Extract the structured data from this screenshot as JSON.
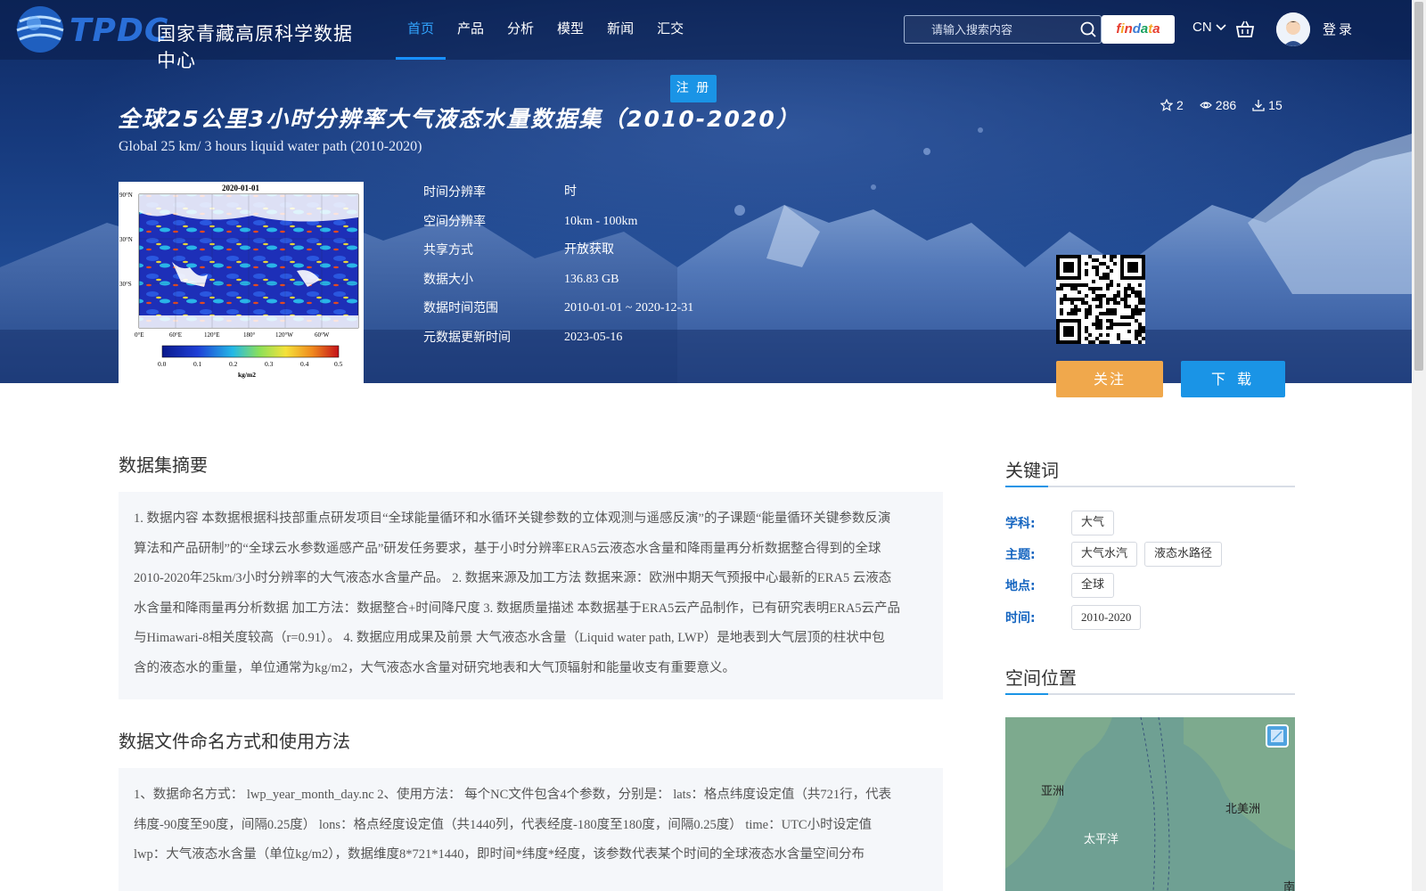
{
  "site": {
    "logo_abbr": "TPDC",
    "logo_name": "国家青藏高原科学数据中心"
  },
  "nav": {
    "items": [
      {
        "label": "首页",
        "active": true
      },
      {
        "label": "产品",
        "active": false
      },
      {
        "label": "分析",
        "active": false
      },
      {
        "label": "模型",
        "active": false
      },
      {
        "label": "新闻",
        "active": false
      },
      {
        "label": "汇交",
        "active": false
      }
    ],
    "search_placeholder": "请输入搜索内容",
    "findata": [
      "f",
      "i",
      "n",
      "d",
      "a",
      "t",
      "a"
    ],
    "findata_colors": [
      "#e63b2e",
      "#f5a623",
      "#e63b2e",
      "#3a7bd5",
      "#1aa260",
      "#f5a623",
      "#e63b2e"
    ],
    "lang": "CN",
    "login": "登录",
    "register": "注 册"
  },
  "dataset": {
    "title_cn": "全球25公里3小时分辨率大气液态水量数据集（2010-2020）",
    "title_en": "Global 25 km/ 3 hours liquid water path (2010-2020)",
    "stats": {
      "stars": "2",
      "views": "286",
      "downloads": "15"
    },
    "thumbnail": {
      "title": "2020-01-01",
      "lat_labels": [
        "90°N",
        "30°N",
        "30°S"
      ],
      "lon_labels": [
        "0°E",
        "60°E",
        "120°E",
        "180°",
        "120°W",
        "60°W"
      ],
      "colorbar_ticks": [
        "0.0",
        "0.1",
        "0.2",
        "0.3",
        "0.4",
        "0.5"
      ],
      "colorbar_unit": "kg/m2"
    },
    "meta": [
      {
        "label": "时间分辨率",
        "value": "时"
      },
      {
        "label": "空间分辨率",
        "value": "10km - 100km"
      },
      {
        "label": "共享方式",
        "value": "开放获取"
      },
      {
        "label": "数据大小",
        "value": "136.83 GB"
      },
      {
        "label": "数据时间范围",
        "value": "2010-01-01 ~ 2020-12-31"
      },
      {
        "label": "元数据更新时间",
        "value": "2023-05-16"
      }
    ],
    "follow_label": "关注",
    "download_label": "下 载"
  },
  "abstract": {
    "title": "数据集摘要",
    "lines": [
      "1. 数据内容 本数据根据科技部重点研发项目“全球能量循环和水循环关键参数的立体观测与遥感反演”的子课题“能量循环关键参数反演",
      "算法和产品研制”的“全球云水参数遥感产品”研发任务要求，基于小时分辨率ERA5云液态水含量和降雨量再分析数据整合得到的全球",
      "2010-2020年25km/3小时分辨率的大气液态水含量产品。 2. 数据来源及加工方法 数据来源：欧洲中期天气预报中心最新的ERA5 云液态",
      "水含量和降雨量再分析数据 加工方法：数据整合+时间降尺度 3. 数据质量描述 本数据基于ERA5云产品制作，已有研究表明ERA5云产品",
      "与Himawari-8相关度较高（r=0.91）。 4. 数据应用成果及前景 大气液态水含量（Liquid water path, LWP）是地表到大气层顶的柱状中包",
      "含的液态水的重量，单位通常为kg/m2，大气液态水含量对研究地表和大气顶辐射和能量收支有重要意义。"
    ]
  },
  "naming": {
    "title": "数据文件命名方式和使用方法",
    "lines": [
      "1、数据命名方式：  lwp_year_month_day.nc 2、使用方法：  每个NC文件包含4个参数，分别是：  lats：格点纬度设定值（共721行，代表",
      "纬度-90度至90度，间隔0.25度）  lons：格点经度设定值（共1440列，代表经度-180度至180度，间隔0.25度）  time：UTC小时设定值",
      "lwp：大气液态水含量（单位kg/m2），数据维度8*721*1440，即时间*纬度*经度，该参数代表某个时间的全球液态水含量空间分布"
    ]
  },
  "keywords": {
    "title": "关键词",
    "rows": [
      {
        "label": "学科:",
        "tags": [
          "大气"
        ]
      },
      {
        "label": "主题:",
        "tags": [
          "大气水汽",
          "液态水路径"
        ]
      },
      {
        "label": "地点:",
        "tags": [
          "全球"
        ]
      },
      {
        "label": "时间:",
        "tags": [
          "2010-2020"
        ]
      }
    ]
  },
  "spatial": {
    "title": "空间位置",
    "labels": {
      "asia": "亚洲",
      "pacific": "太平洋",
      "north_america": "北美洲",
      "south": "南"
    }
  }
}
